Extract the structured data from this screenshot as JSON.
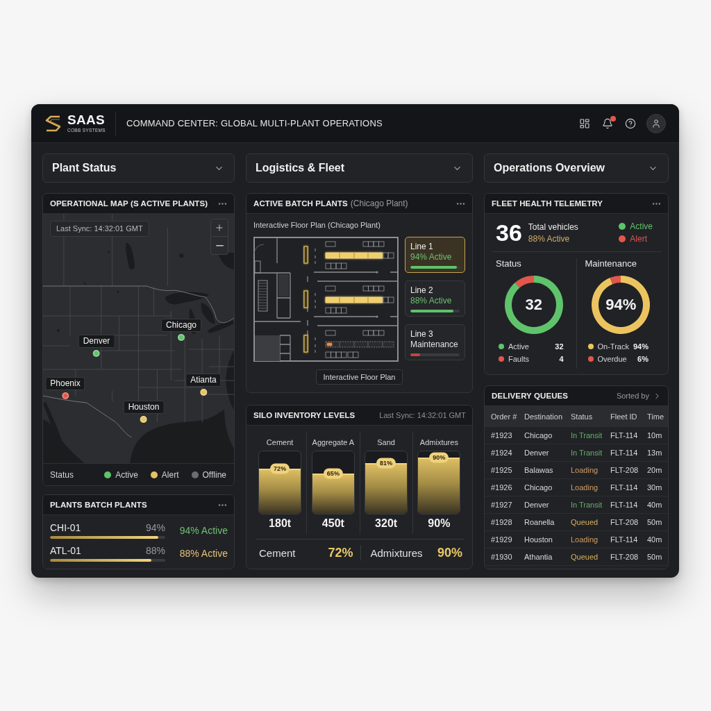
{
  "header": {
    "brand": "SAAS",
    "brand_tagline": "COBB SYSTEMS",
    "title": "COMMAND CENTER: GLOBAL MULTI-PLANT OPERATIONS",
    "notifications_unread": true
  },
  "section_selects": [
    {
      "label": "Plant Status"
    },
    {
      "label": "Logistics & Fleet"
    },
    {
      "label": "Operations Overview"
    }
  ],
  "map_panel": {
    "title": "OPERATIONAL MAP (S ACTIVE PLANTS)",
    "last_sync": "Last Sync: 14:32:01 GMT",
    "pins": [
      {
        "label": "Chicago",
        "color": "#5fc36b"
      },
      {
        "label": "Denver",
        "color": "#5fc36b"
      },
      {
        "label": "Phoenix",
        "color": "#e2574c"
      },
      {
        "label": "Atianta",
        "color": "#e7c264"
      },
      {
        "label": "Houston",
        "color": "#e7c264"
      }
    ],
    "legend": {
      "label": "Status",
      "items": [
        {
          "label": "Active",
          "color": "#5fc36b"
        },
        {
          "label": "Alert",
          "color": "#e7c264"
        },
        {
          "label": "Offline",
          "color": "#6c6d71"
        }
      ]
    }
  },
  "batch_plants_panel": {
    "title": "PLANTS BATCH PLANTS",
    "plants": [
      {
        "code": "CHI-01",
        "percent": "94%",
        "level": 0.94,
        "status": "94% Active",
        "color": "#6cc070"
      },
      {
        "code": "ATL-01",
        "percent": "88%",
        "level": 0.88,
        "status": "88% Active",
        "color": "#e6c27a"
      }
    ]
  },
  "floor_plan_panel": {
    "title": "ACTIVE BATCH PLANTS",
    "title_note": "(Chicago Plant)",
    "subtitle": "Interactive Floor Plan (Chicago Plant)",
    "lines": [
      {
        "name": "Line 1",
        "status": "94% Active",
        "kind": "active",
        "level": 0.94,
        "selected": true
      },
      {
        "name": "Line 2",
        "status": "88% Active",
        "kind": "active",
        "level": 0.88,
        "selected": false
      },
      {
        "name": "Line 3",
        "status": "Maintenance",
        "kind": "maintenance",
        "level": 0.2,
        "selected": false
      }
    ],
    "button": "Interactive Floor Plan"
  },
  "silo_panel": {
    "title": "SILO INVENTORY LEVELS",
    "last_sync": "Last Sync: 14:32:01 GMT",
    "silos": [
      {
        "label": "Cement",
        "badge": "72%",
        "level": 0.72,
        "amount": "180t"
      },
      {
        "label": "Aggregate A",
        "badge": "65%",
        "level": 0.65,
        "amount": "450t"
      },
      {
        "label": "Sand",
        "badge": "81%",
        "level": 0.81,
        "amount": "320t"
      },
      {
        "label": "Admixtures",
        "badge": "90%",
        "level": 0.9,
        "amount": "90%"
      }
    ],
    "summary": [
      {
        "label": "Cement",
        "value": "72%"
      },
      {
        "label": "Admixtures",
        "value": "90%"
      }
    ]
  },
  "fleet_panel": {
    "title": "FLEET HEALTH TELEMETRY",
    "total": "36",
    "total_label": "Total vehicles",
    "active_share": "88% Active",
    "legend": [
      {
        "label": "Active",
        "color": "#5fc36b"
      },
      {
        "label": "Alert",
        "color": "#e2574c"
      }
    ],
    "gauges": [
      {
        "title": "Status",
        "center": "32",
        "chart_data": {
          "type": "donut",
          "categories": [
            "Active",
            "Faults"
          ],
          "values": [
            32,
            4
          ],
          "value_labels": [
            "32",
            "4"
          ]
        },
        "slices": [
          {
            "color": "#5fc36b"
          },
          {
            "color": "#e2574c"
          }
        ]
      },
      {
        "title": "Maintenance",
        "center": "94%",
        "chart_data": {
          "type": "donut",
          "categories": [
            "On-Track",
            "Overdue"
          ],
          "values": [
            94,
            6
          ],
          "value_labels": [
            "94%",
            "6%"
          ]
        },
        "slices": [
          {
            "color": "#ecc45f"
          },
          {
            "color": "#e2574c"
          }
        ]
      }
    ]
  },
  "delivery_panel": {
    "title": "DELIVERY QUEUES",
    "sort_label": "Sorted by",
    "columns": [
      "Order #",
      "Destination",
      "Status",
      "Fleet ID",
      "Time"
    ],
    "rows": [
      {
        "order": "#1923",
        "destination": "Chicago",
        "status": "In Transit",
        "color": "#62b06a",
        "fleet_id": "FLT-114",
        "time": "10m"
      },
      {
        "order": "#1924",
        "destination": "Denver",
        "status": "In Transit",
        "color": "#62b06a",
        "fleet_id": "FLT-114",
        "time": "13m"
      },
      {
        "order": "#1925",
        "destination": "Balawas",
        "status": "Loading",
        "color": "#cf9f62",
        "fleet_id": "FLT-208",
        "time": "20m"
      },
      {
        "order": "#1926",
        "destination": "Chicago",
        "status": "Loading",
        "color": "#cf9f62",
        "fleet_id": "FLT-114",
        "time": "30m"
      },
      {
        "order": "#1927",
        "destination": "Denver",
        "status": "In Transit",
        "color": "#62b06a",
        "fleet_id": "FLT-114",
        "time": "40m"
      },
      {
        "order": "#1928",
        "destination": "Roanella",
        "status": "Queued",
        "color": "#d8b05c",
        "fleet_id": "FLT-208",
        "time": "50m"
      },
      {
        "order": "#1929",
        "destination": "Houston",
        "status": "Loading",
        "color": "#cf9f62",
        "fleet_id": "FLT-114",
        "time": "40m"
      },
      {
        "order": "#1930",
        "destination": "Athantia",
        "status": "Queued",
        "color": "#d8b05c",
        "fleet_id": "FLT-208",
        "time": "50m"
      }
    ]
  }
}
